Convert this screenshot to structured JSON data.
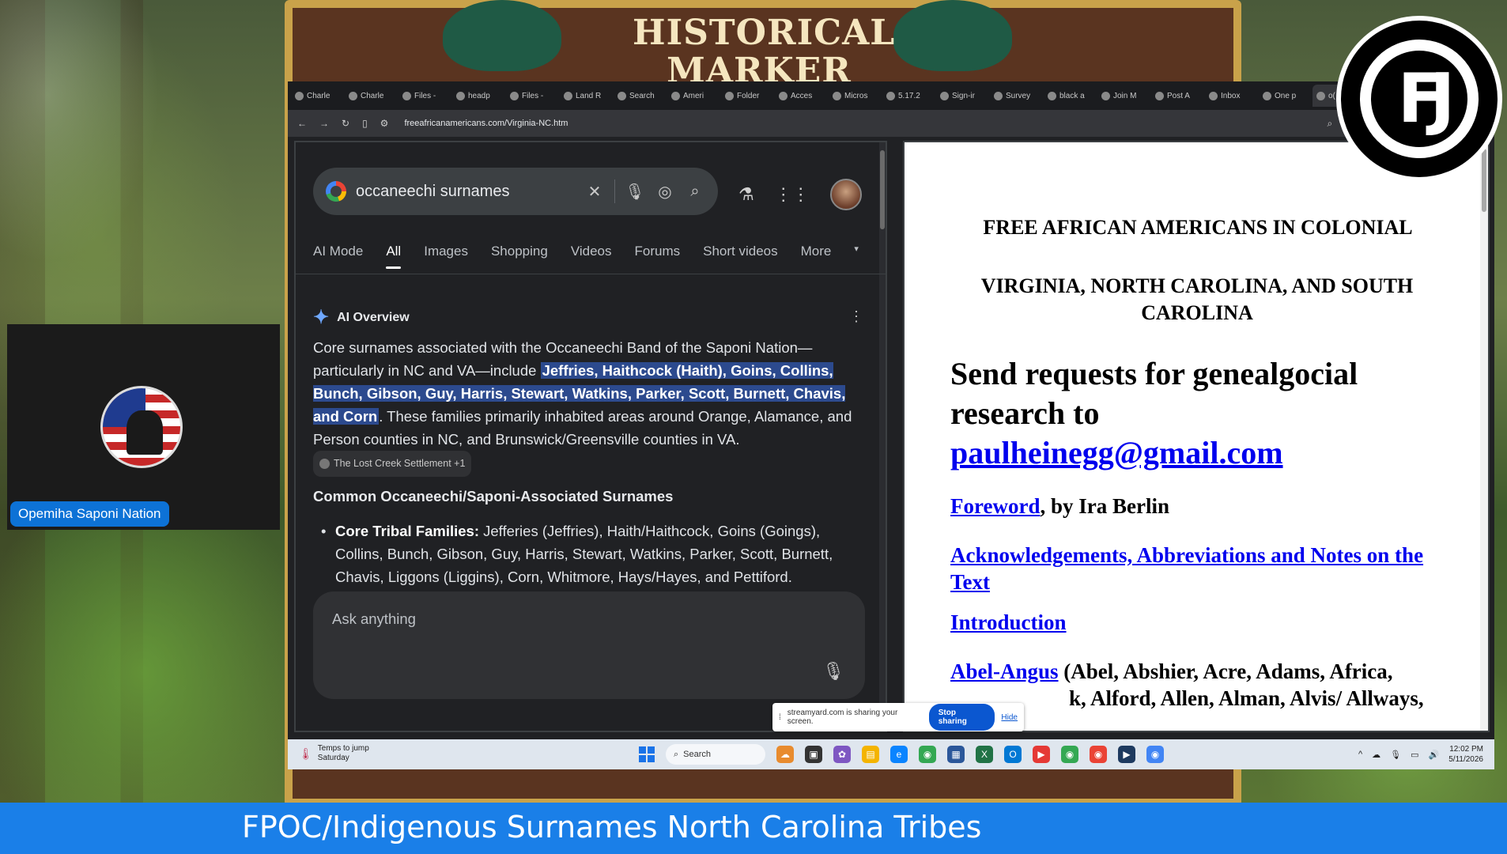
{
  "background": {
    "sign_title": "HISTORICAL MARKER"
  },
  "browser": {
    "tabs": [
      "Charle",
      "Charle",
      "Files -",
      "headp",
      "Files -",
      "Land R",
      "Search",
      "Ameri",
      "Folder",
      "Acces",
      "Micros",
      "5.17.2",
      "Sign-ir",
      "Survey",
      "black a",
      "Join M",
      "Post A",
      "Inbox",
      "One p",
      "o("
    ],
    "url": "freeafricanamericans.com/Virginia-NC.htm"
  },
  "google": {
    "query": "occaneechi surnames",
    "tabs": [
      "AI Mode",
      "All",
      "Images",
      "Shopping",
      "Videos",
      "Forums",
      "Short videos",
      "More"
    ],
    "active_tab": "All",
    "ai_overview_title": "AI Overview",
    "overview_pre": "Core surnames associated with the Occaneechi Band of the Saponi Nation—particularly in NC and VA—include ",
    "overview_highlight": "Jeffries, Haithcock (Haith), Goins, Collins, Bunch, Gibson, Guy, Harris, Stewart, Watkins, Parker, Scott, Burnett, Chavis, and Corn",
    "overview_post": ". These families primarily inhabited areas around Orange, Alamance, and Person counties in NC, and Brunswick/Greensville counties in VA.",
    "citation": "The Lost Creek Settlement +1",
    "subheading": "Common Occaneechi/Saponi-Associated Surnames",
    "bullet_label": "Core Tribal Families:",
    "bullet_text": " Jefferies (Jeffries), Haith/Haithcock, Goins (Goings), Collins, Bunch, Gibson, Guy, Harris, Stewart, Watkins, Parker, Scott, Burnett, Chavis, Liggons (Liggins), Corn, Whitmore, Hays/Hayes, and Pettiford.",
    "ask_placeholder": "Ask anything"
  },
  "page": {
    "title1": "FREE AFRICAN AMERICANS IN COLONIAL",
    "title2": "VIRGINIA,  NORTH CAROLINA, AND SOUTH CAROLINA",
    "send_text": "Send requests for genealgocial research to",
    "email": "paulheinegg@gmail.com",
    "foreword_link": "Foreword",
    "foreword_rest": ", by Ira Berlin",
    "ack_link": "Acknowledgements, Abbreviations and Notes on the Text",
    "intro_link": "Introduction",
    "abel_link": "Abel-Angus",
    "abel_rest": " (Abel, Abshier, Acre, Adams, Africa,",
    "abel_rest2": "k, Alford, Allen, Alman, Alvis/ Allways,"
  },
  "share_notice": {
    "text": "streamyard.com is sharing your screen.",
    "stop": "Stop sharing",
    "hide": "Hide"
  },
  "taskbar": {
    "weather_line1": "Temps to jump",
    "weather_line2": "Saturday",
    "search": "Search",
    "time": "12:02 PM",
    "date": "5/11/2026"
  },
  "webcam": {
    "name": "Opemiha Saponi Nation"
  },
  "banner": {
    "text": "FPOC/Indigenous Surnames North Carolina Tribes"
  },
  "colors": {
    "banner": "#1a7fe8",
    "highlight": "#2c4a8e",
    "link": "#0000ee"
  }
}
